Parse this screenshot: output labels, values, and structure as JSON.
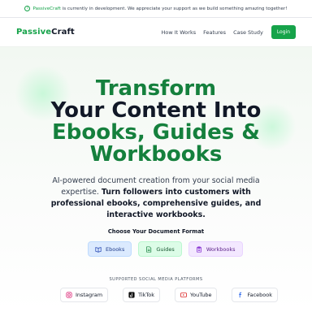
{
  "banner": {
    "brand": "PassiveCraft",
    "text": " is currently in development. We appreciate your support as we build something amazing together!"
  },
  "nav": {
    "logo_green": "Passive",
    "logo_dark": "Craft",
    "links": [
      "How It Works",
      "Features",
      "Case Study"
    ],
    "login_label": "Login"
  },
  "hero": {
    "line1": "Transform",
    "line2": "Your Content Into",
    "line3": "Ebooks, Guides &",
    "line4": "Workbooks",
    "sub_plain": "AI-powered document creation from your social media expertise. ",
    "sub_bold": "Turn followers into customers with professional ebooks, comprehensive guides, and interactive workbooks.",
    "choose_label": "Choose Your Document Format",
    "formats": [
      "Ebooks",
      "Guides",
      "Workbooks"
    ],
    "supported_label": "SUPPORTED SOCIAL MEDIA PLATFORMS",
    "platforms": [
      "Instagram",
      "TikTok",
      "YouTube",
      "Facebook"
    ]
  },
  "colors": {
    "accent": "#16a34a",
    "ebooks_bg": "#dbeafe",
    "guides_bg": "#dcfce7",
    "workbooks_bg": "#f3e8ff"
  }
}
